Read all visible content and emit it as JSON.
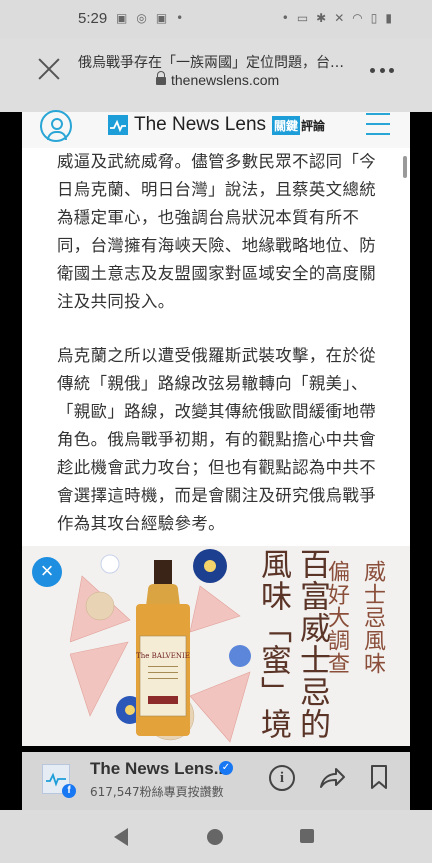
{
  "status_bar": {
    "time": "5:29",
    "left_icons": [
      "android-icon",
      "whatsapp-icon",
      "android-icon",
      "dot-icon"
    ],
    "right_icons": [
      "dot-icon",
      "cast-off-icon",
      "bluetooth-icon",
      "mute-icon",
      "wifi-icon",
      "no-sim-icon",
      "battery-icon"
    ]
  },
  "browser": {
    "page_title": "俄烏戰爭存在「一族兩國」定位問題，台…",
    "url": "thenewslens.com"
  },
  "site_header": {
    "logo_text": "The News Lens",
    "logo_sub_1": "關鍵",
    "logo_sub_2": "評論",
    "accent_color": "#1e9ed8"
  },
  "article": {
    "paragraphs": [
      "威逼及武統威脅。儘管多數民眾不認同「今日烏克蘭、明日台灣」說法，且蔡英文總統為穩定軍心，也強調台烏狀況本質有所不同，台灣擁有海峽天險、地緣戰略地位、防衛國土意志及友盟國家對區域安全的高度關注及共同投入。",
      "烏克蘭之所以遭受俄羅斯武裝攻擊，在於從傳統「親俄」路線改弦易轍轉向「親美」、「親歐」路線，改變其傳統俄歐間緩衝地帶角色。俄烏戰爭初期，有的觀點擔心中共會趁此機會武力攻台；但也有觀點認為中共不會選擇這時機，而是會關注及研究俄烏戰爭作為其攻台經驗參考。"
    ]
  },
  "ad": {
    "close_label": "×",
    "lines": [
      "威士忌風味",
      "偏好大調查",
      "百富威士忌的",
      "風味「蜜」境"
    ],
    "bottle_brand": "The BALVENIE"
  },
  "bottom_bar": {
    "page_name": "The News Lens...",
    "followers": "617,547粉絲專頁按讚數",
    "info_label": "i"
  }
}
